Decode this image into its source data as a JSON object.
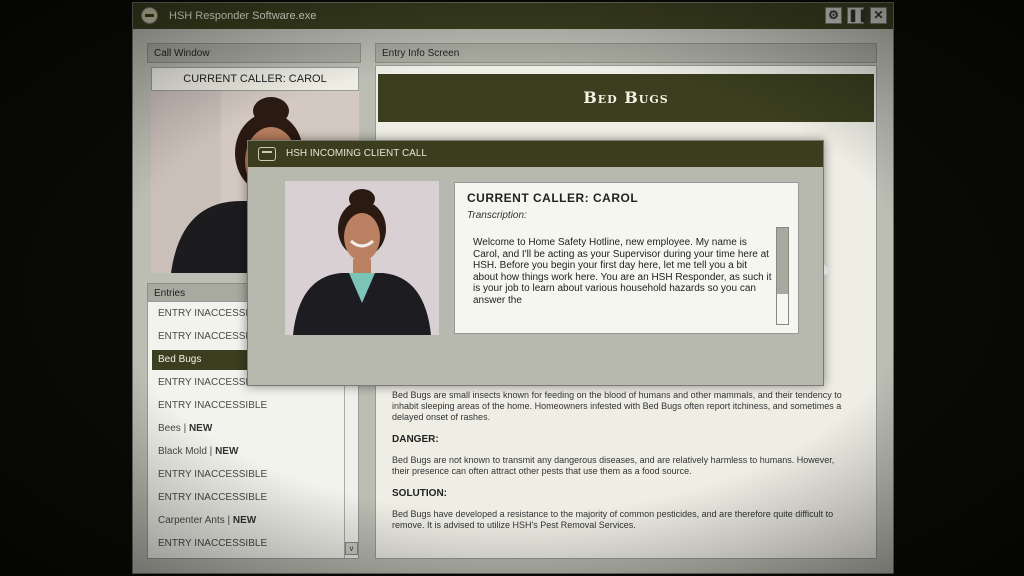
{
  "window": {
    "title": "HSH Responder Software.exe",
    "buttons": [
      "settings-icon",
      "pause-icon",
      "close-icon"
    ]
  },
  "call_window": {
    "header": "Call Window",
    "caller_label": "CURRENT CALLER: CAROL"
  },
  "entries": {
    "header": "Entries",
    "items": [
      {
        "label": "ENTRY INACCESSIBLE",
        "badge": ""
      },
      {
        "label": "ENTRY INACCESSIBLE",
        "badge": ""
      },
      {
        "label": "Bed Bugs",
        "badge": "",
        "selected": true
      },
      {
        "label": "ENTRY INACCESSIBLE",
        "badge": ""
      },
      {
        "label": "ENTRY INACCESSIBLE",
        "badge": ""
      },
      {
        "label": "Bees | ",
        "badge": "NEW"
      },
      {
        "label": "Black Mold | ",
        "badge": "NEW"
      },
      {
        "label": "ENTRY INACCESSIBLE",
        "badge": ""
      },
      {
        "label": "ENTRY INACCESSIBLE",
        "badge": ""
      },
      {
        "label": "Carpenter Ants | ",
        "badge": "NEW"
      },
      {
        "label": "ENTRY INACCESSIBLE",
        "badge": ""
      }
    ],
    "scroll_down": "v"
  },
  "entry_info": {
    "header": "Entry Info Screen",
    "title": "Bed Bugs",
    "description": "Bed Bugs are small insects known for feeding on the blood of humans and other mammals, and their tendency to inhabit sleeping areas of the home. Homeowners infested with Bed Bugs often report itchiness, and sometimes a delayed onset of rashes.",
    "danger_label": "DANGER:",
    "danger_text": "Bed Bugs are not known to transmit any dangerous diseases, and are relatively harmless to humans. However, their presence can often attract other pests that use them as a food source.",
    "solution_label": "SOLUTION:",
    "solution_text": "Bed Bugs have developed a resistance to the majority of common pesticides, and are therefore quite difficult to remove. It is advised to utilize HSH's Pest Removal Services."
  },
  "dialog": {
    "title": "HSH INCOMING CLIENT CALL",
    "caller": "CURRENT CALLER: CAROL",
    "transcription_label": "Transcription:",
    "transcription": "Welcome to Home Safety Hotline, new employee. My name is Carol, and I'll be acting as your Supervisor during your time here at HSH. Before you begin your first day here, let me tell you a bit about how things work here. You are an HSH Responder, as such it is your job to learn about various household hazards so you can answer the"
  },
  "colors": {
    "titlebar": "#3a3e1f",
    "window_bg": "#bcbdb3",
    "panel_bg": "#efeee5",
    "selected": "#3b3f1f"
  }
}
